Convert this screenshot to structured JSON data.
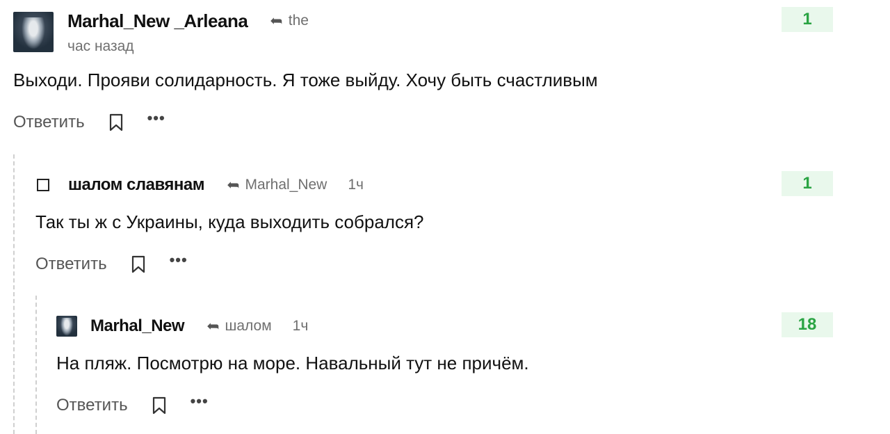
{
  "comments": [
    {
      "username": "Marhal_New _Arleana",
      "reply_to": "the",
      "time": "час назад",
      "score": "1",
      "text": "Выходи. Прояви солидарность. Я тоже выйду. Хочу быть счастливым",
      "reply_label": "Ответить",
      "more_label": "•••",
      "avatar_icon": "user-avatar-photo"
    },
    {
      "username": "шалом славянам",
      "reply_to": "Marhal_New",
      "time": "1ч",
      "score": "1",
      "text": "Так ты ж с Украины, куда выходить собрался?",
      "reply_label": "Ответить",
      "more_label": "•••",
      "avatar_icon": "empty-avatar-checkbox"
    },
    {
      "username": "Marhal_New",
      "reply_to": "шалом",
      "time": "1ч",
      "score": "18",
      "text": "На пляж. Посмотрю на море. Навальный тут не причём.",
      "reply_label": "Ответить",
      "more_label": "•••",
      "avatar_icon": "user-avatar-photo"
    }
  ],
  "colors": {
    "score_bg": "#e9f8ec",
    "score_text": "#2aa443",
    "muted_text": "#6f6f6f",
    "thread_line": "#cfcfcf"
  }
}
